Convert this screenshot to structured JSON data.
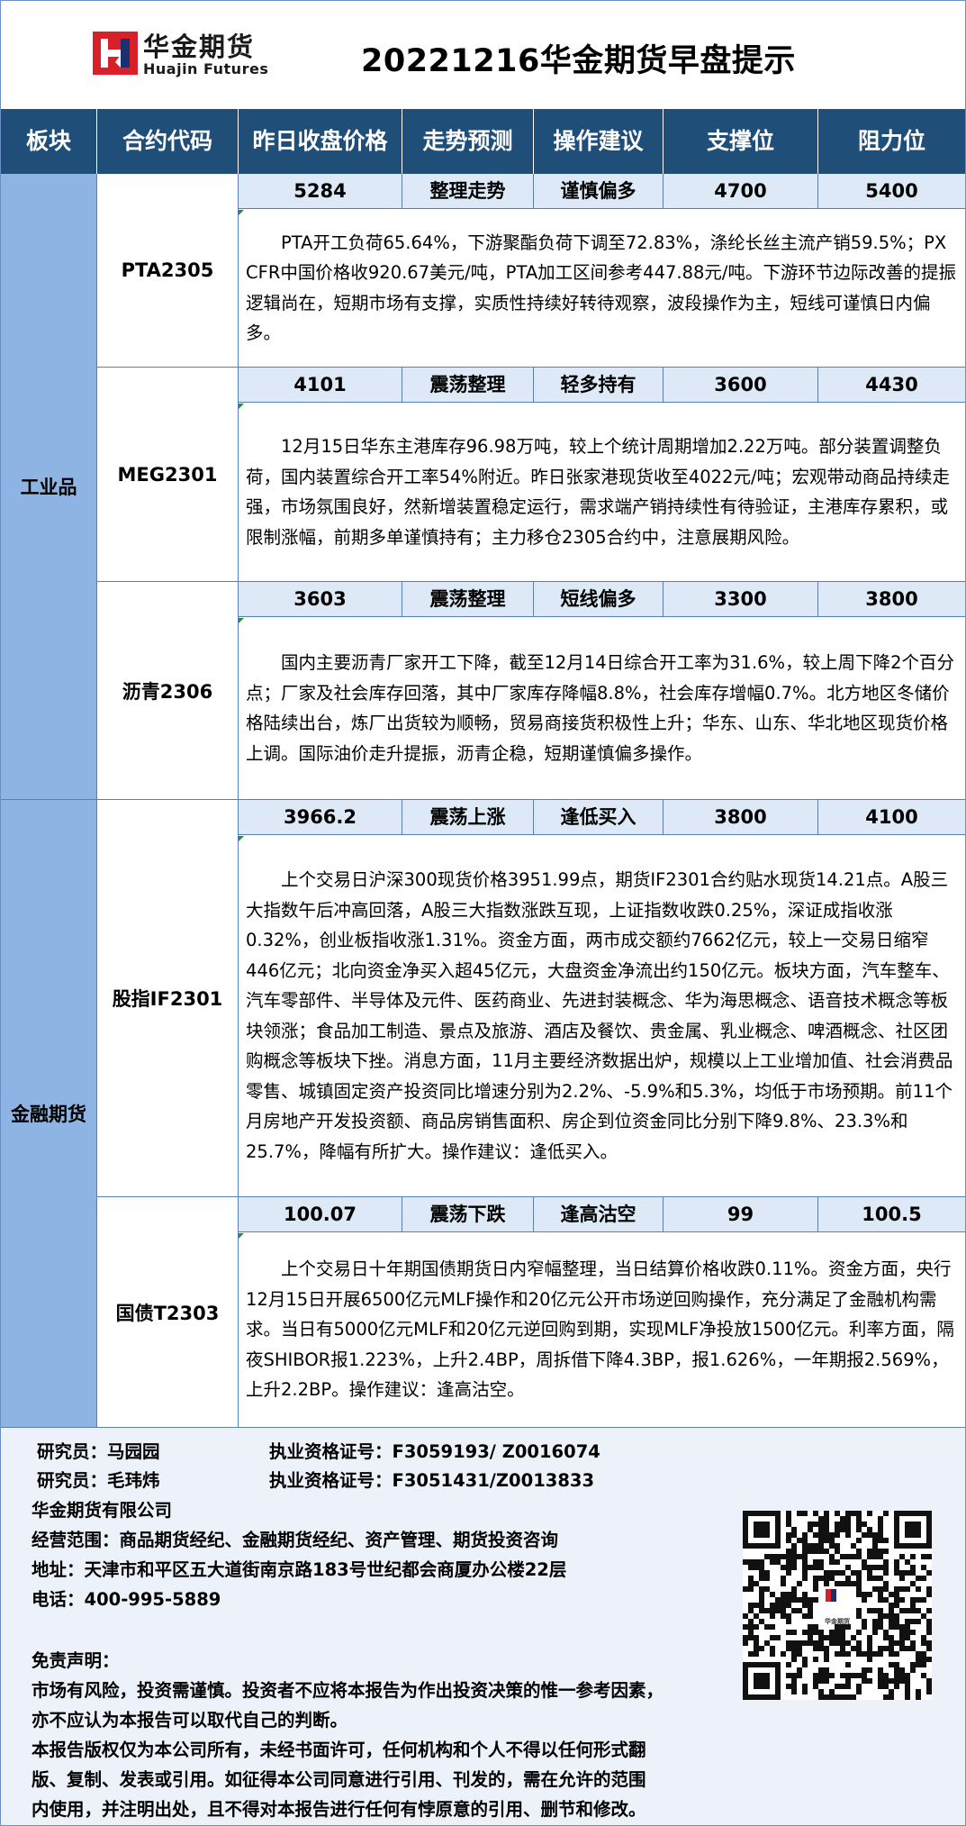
{
  "header": {
    "brand_cn": "华金期货",
    "brand_en": "Huajin Futures",
    "title": "20221216华金期货早盘提示"
  },
  "columns": [
    "板块",
    "合约代码",
    "昨日收盘价格",
    "走势预测",
    "操作建议",
    "支撑位",
    "阻力位"
  ],
  "sectors": [
    {
      "name": "工业品"
    },
    {
      "name": "金融期货"
    }
  ],
  "rows": [
    {
      "code": "PTA2305",
      "close": "5284",
      "trend": "整理走势",
      "advice": "谨慎偏多",
      "support": "4700",
      "resistance": "5400",
      "desc": "PTA开工负荷65.64%，下游聚酯负荷下调至72.83%，涤纶长丝主流产销59.5%；PX CFR中国价格收920.67美元/吨，PTA加工区间参考447.88元/吨。下游环节边际改善的提振逻辑尚在，短期市场有支撑，实质性持续好转待观察，波段操作为主，短线可谨慎日内偏多。"
    },
    {
      "code": "MEG2301",
      "close": "4101",
      "trend": "震荡整理",
      "advice": "轻多持有",
      "support": "3600",
      "resistance": "4430",
      "desc": "12月15日华东主港库存96.98万吨，较上个统计周期增加2.22万吨。部分装置调整负荷，国内装置综合开工率54%附近。昨日张家港现货收至4022元/吨；宏观带动商品持续走强，市场氛围良好，然新增装置稳定运行，需求端产销持续性有待验证，主港库存累积，或限制涨幅，前期多单谨慎持有；主力移仓2305合约中，注意展期风险。"
    },
    {
      "code": "沥青2306",
      "close": "3603",
      "trend": "震荡整理",
      "advice": "短线偏多",
      "support": "3300",
      "resistance": "3800",
      "desc": "国内主要沥青厂家开工下降，截至12月14日综合开工率为31.6%，较上周下降2个百分点；厂家及社会库存回落，其中厂家库存降幅8.8%，社会库存增幅0.7%。北方地区冬储价格陆续出台，炼厂出货较为顺畅，贸易商接货积极性上升；华东、山东、华北地区现货价格上调。国际油价走升提振，沥青企稳，短期谨慎偏多操作。"
    },
    {
      "code": "股指IF2301",
      "close": "3966.2",
      "trend": "震荡上涨",
      "advice": "逢低买入",
      "support": "3800",
      "resistance": "4100",
      "desc": "上个交易日沪深300现货价格3951.99点，期货IF2301合约贴水现货14.21点。A股三大指数午后冲高回落，A股三大指数涨跌互现，上证指数收跌0.25%，深证成指收涨0.32%，创业板指收涨1.31%。资金方面，两市成交额约7662亿元，较上一交易日缩窄446亿元；北向资金净买入超45亿元，大盘资金净流出约150亿元。板块方面，汽车整车、汽车零部件、半导体及元件、医药商业、先进封装概念、华为海思概念、语音技术概念等板块领涨；食品加工制造、景点及旅游、酒店及餐饮、贵金属、乳业概念、啤酒概念、社区团购概念等板块下挫。消息方面，11月主要经济数据出炉，规模以上工业增加值、社会消费品零售、城镇固定资产投资同比增速分别为2.2%、-5.9%和5.3%，均低于市场预期。前11个月房地产开发投资额、商品房销售面积、房企到位资金同比分别下降9.8%、23.3%和25.7%，降幅有所扩大。操作建议：逢低买入。"
    },
    {
      "code": "国债T2303",
      "close": "100.07",
      "trend": "震荡下跌",
      "advice": "逢高沽空",
      "support": "99",
      "resistance": "100.5",
      "desc": "上个交易日十年期国债期货日内窄幅整理，当日结算价格收跌0.11%。资金方面，央行12月15日开展6500亿元MLF操作和20亿元公开市场逆回购操作，充分满足了金融机构需求。当日有5000亿元MLF和20亿元逆回购到期，实现MLF净投放1500亿元。利率方面，隔夜SHIBOR报1.223%，上升2.4BP，周拆借下降4.3BP，报1.626%，一年期报2.569%，上升2.2BP。操作建议：逢高沽空。"
    }
  ],
  "footer": {
    "researcher1": "研究员：马园园",
    "license1": "执业资格证号：F3059193/ Z0016074",
    "researcher2": "研究员：毛玮炜",
    "license2": "执业资格证号：F3051431/Z0013833",
    "company": "华金期货有限公司",
    "scope": "经营范围：商品期货经纪、金融期货经纪、资产管理、期货投资咨询",
    "address": "地址：天津市和平区五大道街南京路183号世纪都会商厦办公楼22层",
    "phone": "电话：400-995-5889",
    "disclaimer_title": "免责声明：",
    "disclaimer_lines": [
      "市场有风险，投资需谨慎。投资者不应将本报告为作出投资决策的惟一参考因素，",
      "亦不应认为本报告可以取代自己的判断。",
      "本报告版权仅为本公司所有，未经书面许可，任何机构和个人不得以任何形式翻",
      "版、复制、发表或引用。如征得本公司同意进行引用、刊发的，需在允许的范围",
      "内使用，并注明出处，且不得对本报告进行任何有悖原意的引用、删节和修改。"
    ],
    "qr_logo_text": "华金期货"
  },
  "colors": {
    "header_bg": "#1f4e79",
    "sector_bg": "#8db4e2",
    "value_row_bg": "#dde9f7",
    "footer_bg": "#ecf1fa",
    "logo_red": "#d7202a",
    "logo_navy": "#1c2f6e"
  }
}
